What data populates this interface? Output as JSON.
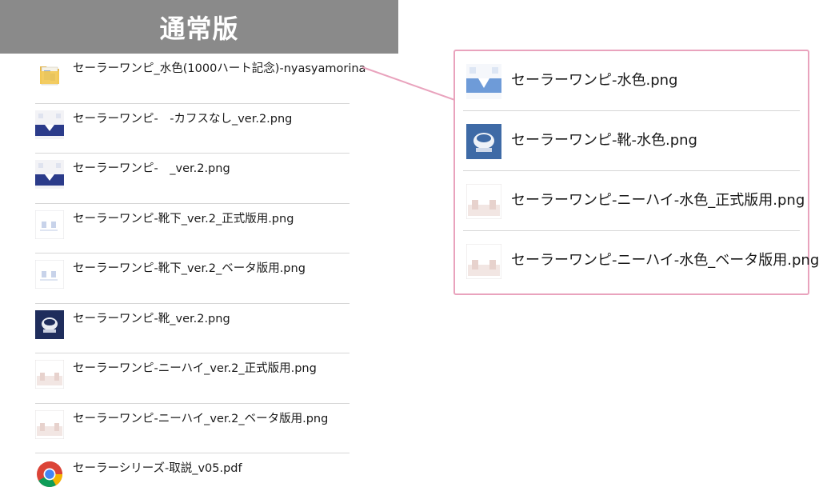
{
  "header": {
    "title": "通常版"
  },
  "files": [
    {
      "name": "セーラーワンピ_水色(1000ハート記念)-nyasyamorina",
      "icon": "folder-icon"
    },
    {
      "name": "セーラーワンピ-　-カフスなし_ver.2.png",
      "icon": "image-thumb-dress-icon"
    },
    {
      "name": "セーラーワンピ-　_ver.2.png",
      "icon": "image-thumb-dress-icon"
    },
    {
      "name": "セーラーワンピ-靴下_ver.2_正式版用.png",
      "icon": "image-thumb-socks-icon"
    },
    {
      "name": "セーラーワンピ-靴下_ver.2_ベータ版用.png",
      "icon": "image-thumb-socks-icon"
    },
    {
      "name": "セーラーワンピ-靴_ver.2.png",
      "icon": "image-thumb-shoes-icon"
    },
    {
      "name": "セーラーワンピ-ニーハイ_ver.2_正式版用.png",
      "icon": "image-thumb-kneehigh-icon"
    },
    {
      "name": "セーラーワンピ-ニーハイ_ver.2_ベータ版用.png",
      "icon": "image-thumb-kneehigh-icon"
    },
    {
      "name": "セーラーシリーズ-取説_v05.pdf",
      "icon": "chrome-pdf-icon"
    }
  ],
  "callout": {
    "files": [
      {
        "name": "セーラーワンピ-水色.png",
        "icon": "image-thumb-lightblue-dress-icon"
      },
      {
        "name": "セーラーワンピ-靴-水色.png",
        "icon": "image-thumb-lightblue-shoes-icon"
      },
      {
        "name": "セーラーワンピ-ニーハイ-水色_正式版用.png",
        "icon": "image-thumb-kneehigh-icon"
      },
      {
        "name": "セーラーワンピ-ニーハイ-水色_ベータ版用.png",
        "icon": "image-thumb-kneehigh-icon"
      }
    ],
    "border_color": "#e9a3bd"
  },
  "colors": {
    "header_bg": "#8a8a8a",
    "header_text": "#ffffff",
    "divider": "#d6d6d6"
  }
}
